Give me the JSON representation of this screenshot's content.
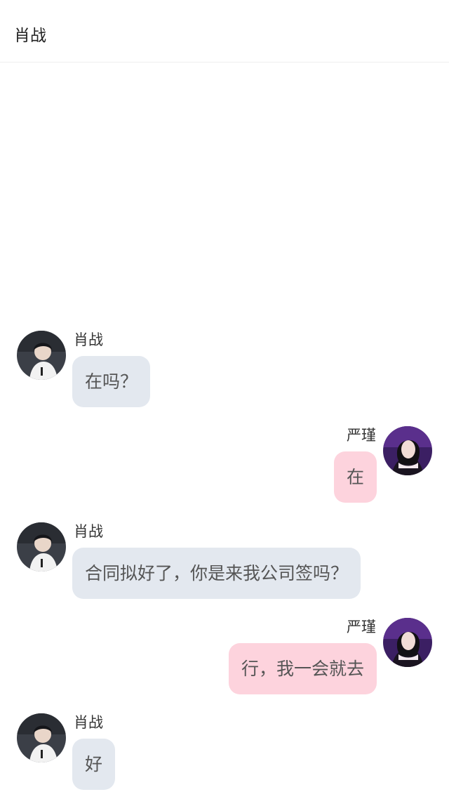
{
  "header": {
    "title": "肖战"
  },
  "messages": [
    {
      "side": "left",
      "sender": "肖战",
      "text": "在吗？",
      "avatar": "avatar-xiao-zhan"
    },
    {
      "side": "right",
      "sender": "严瑾",
      "text": "在",
      "avatar": "avatar-yan-jin"
    },
    {
      "side": "left",
      "sender": "肖战",
      "text": "合同拟好了，你是来我公司签吗？",
      "avatar": "avatar-xiao-zhan"
    },
    {
      "side": "right",
      "sender": "严瑾",
      "text": "行，我一会就去",
      "avatar": "avatar-yan-jin"
    },
    {
      "side": "left",
      "sender": "肖战",
      "text": "好",
      "avatar": "avatar-xiao-zhan"
    }
  ],
  "colors": {
    "incoming_bubble": "#e3e8ef",
    "outgoing_bubble": "#fdd3dd",
    "background": "#ffffff"
  }
}
